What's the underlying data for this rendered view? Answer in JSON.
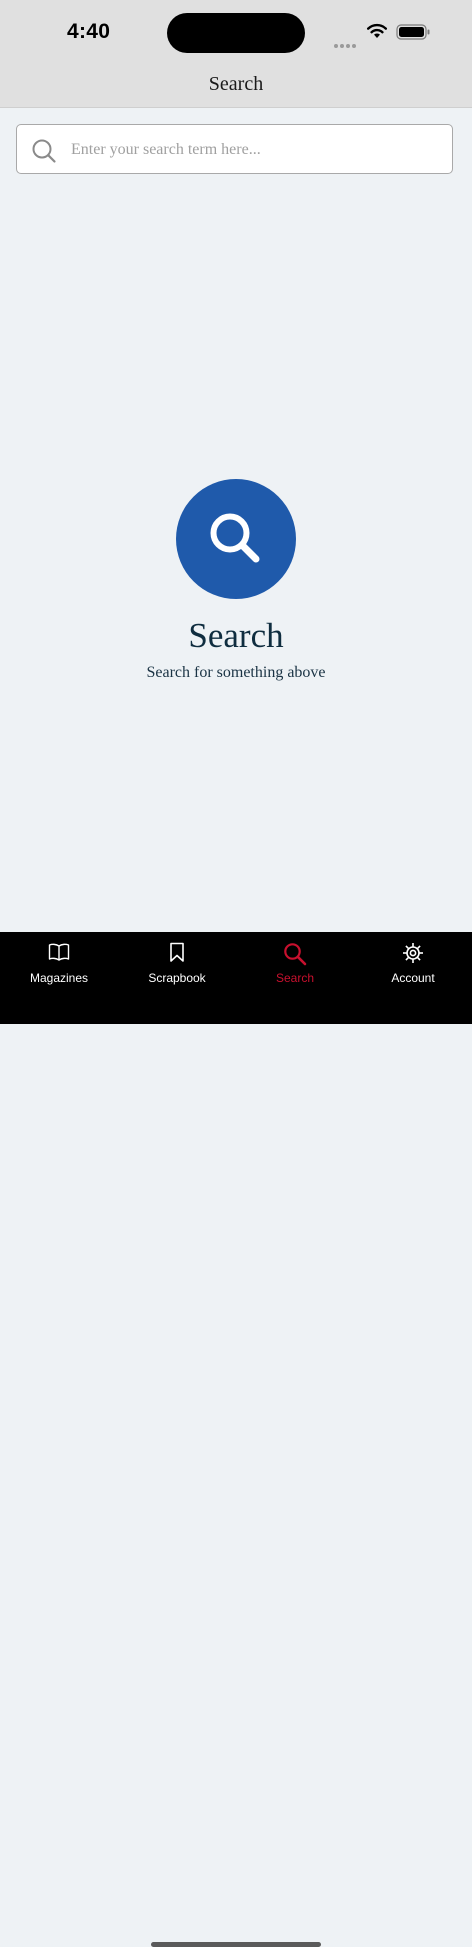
{
  "status_bar": {
    "time": "4:40"
  },
  "nav": {
    "title": "Search"
  },
  "search": {
    "placeholder": "Enter your search term here...",
    "value": ""
  },
  "empty_state": {
    "title": "Search",
    "subtitle": "Search for something above",
    "icon": "search-icon"
  },
  "tabs": [
    {
      "label": "Magazines",
      "icon": "book-icon",
      "active": false
    },
    {
      "label": "Scrapbook",
      "icon": "bookmark-icon",
      "active": false
    },
    {
      "label": "Search",
      "icon": "search-icon",
      "active": true
    },
    {
      "label": "Account",
      "icon": "gear-icon",
      "active": false
    }
  ],
  "colors": {
    "accent": "#1f5aab",
    "active_tab": "#c8102e",
    "background": "#eef2f5"
  }
}
